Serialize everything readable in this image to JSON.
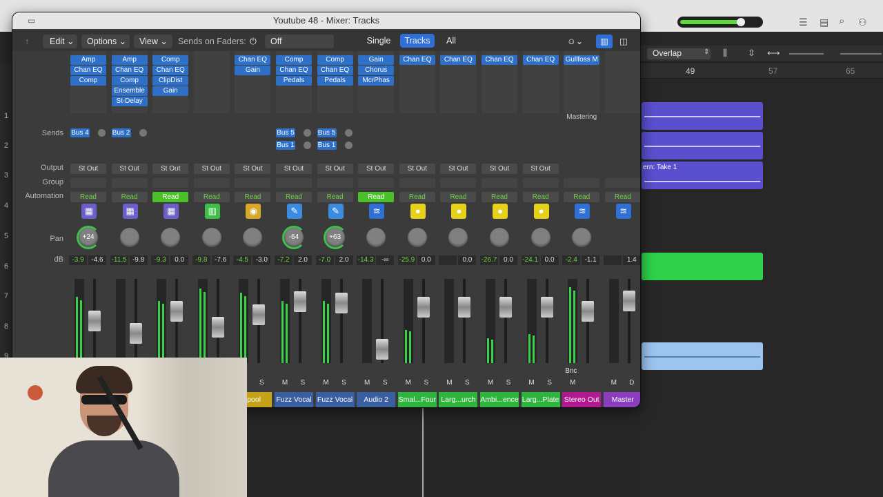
{
  "window": {
    "title": "Youtube 48 - Mixer: Tracks"
  },
  "toolbar": {
    "edit": "Edit",
    "options": "Options",
    "view": "View",
    "sends_label": "Sends on Faders:",
    "sends_value": "Off",
    "single": "Single",
    "tracks": "Tracks",
    "all": "All"
  },
  "arrange": {
    "mode": "Overlap",
    "bar1": "49",
    "bar2": "57",
    "bar3": "65",
    "region_text": "ern: Take 1"
  },
  "row_numbers": [
    "1",
    "2",
    "3",
    "4",
    "5",
    "6",
    "7",
    "8",
    "9"
  ],
  "row_labels": {
    "sends": "Sends",
    "output": "Output",
    "group": "Group",
    "automation": "Automation",
    "pan": "Pan",
    "db": "dB"
  },
  "strips": [
    {
      "name": "",
      "plugins": [
        "Amp",
        "Chan EQ",
        "Comp"
      ],
      "sends": [
        "Bus 4"
      ],
      "output": "St Out",
      "auto": "Read",
      "auto_on": false,
      "icon": "amp-icon",
      "pan": "+24",
      "db1": "-3.9",
      "db2": "-4.6",
      "fader": 0.5,
      "meter": 0.8,
      "color": "#3a3a3a",
      "buttons": "M S"
    },
    {
      "name": "",
      "plugins": [
        "Amp",
        "Chan EQ",
        "Comp",
        "Ensemble",
        "St-Delay"
      ],
      "sends": [
        "Bus 2"
      ],
      "output": "St Out",
      "auto": "Read",
      "auto_on": false,
      "icon": "amp-icon",
      "pan": "",
      "db1": "-11.5",
      "db2": "-9.8",
      "fader": 0.3,
      "meter": 0,
      "color": "#3a3a3a",
      "buttons": "M S"
    },
    {
      "name": "",
      "plugins": [
        "Comp",
        "Chan EQ",
        "ClipDist",
        "Gain"
      ],
      "sends": [],
      "output": "St Out",
      "auto": "Read",
      "auto_on": true,
      "icon": "amp-icon",
      "pan": "",
      "db1": "-9.3",
      "db2": "0.0",
      "fader": 0.65,
      "meter": 0.75,
      "color": "#3a3a3a",
      "buttons": "M S"
    },
    {
      "name": "",
      "plugins": [],
      "sends": [],
      "output": "St Out",
      "auto": "Read",
      "auto_on": false,
      "icon": "synth-icon",
      "pan": "",
      "db1": "-9.8",
      "db2": "-7.6",
      "fader": 0.4,
      "meter": 0.9,
      "color": "#3a3a3a",
      "buttons": "M S"
    },
    {
      "name": "rpool",
      "plugins": [
        "Chan EQ",
        "Gain"
      ],
      "sends": [],
      "output": "St Out",
      "auto": "Read",
      "auto_on": false,
      "icon": "drum-icon",
      "pan": "",
      "db1": "-4.5",
      "db2": "-3.0",
      "fader": 0.6,
      "meter": 0.85,
      "color": "#c4a21a",
      "buttons": "M S"
    },
    {
      "name": "Fuzz Vocal",
      "plugins": [
        "Comp",
        "Chan EQ",
        "Pedals"
      ],
      "sends": [
        "Bus 5",
        "Bus 1"
      ],
      "output": "St Out",
      "auto": "Read",
      "auto_on": false,
      "icon": "guitar-icon",
      "pan": "-64",
      "db1": "-7.2",
      "db2": "2.0",
      "fader": 0.8,
      "meter": 0.75,
      "color": "#3a5fa0",
      "buttons": "M S"
    },
    {
      "name": "Fuzz Vocal",
      "plugins": [
        "Comp",
        "Chan EQ",
        "Pedals"
      ],
      "sends": [
        "Bus 5",
        "Bus 1"
      ],
      "output": "St Out",
      "auto": "Read",
      "auto_on": false,
      "icon": "guitar-icon",
      "pan": "+63",
      "db1": "-7.0",
      "db2": "2.0",
      "fader": 0.78,
      "meter": 0.75,
      "color": "#3a5fa0",
      "buttons": "M S"
    },
    {
      "name": "Audio 2",
      "plugins": [
        "Gain",
        "Chorus",
        "McrPhas"
      ],
      "sends": [],
      "output": "St Out",
      "auto": "Read",
      "auto_on": true,
      "icon": "wave-icon",
      "pan": "",
      "db1": "-14.3",
      "db2": "-∞",
      "fader": 0.05,
      "meter": 0,
      "color": "#3a5fa0",
      "buttons": "M S"
    },
    {
      "name": "Smal...Four",
      "plugins": [
        "Chan EQ"
      ],
      "sends": [],
      "output": "St Out",
      "auto": "Read",
      "auto_on": false,
      "icon": "aux-icon",
      "pan": "",
      "db1": "-25.9",
      "db2": "0.0",
      "fader": 0.72,
      "meter": 0.4,
      "color": "#2fb53e",
      "buttons": "M S"
    },
    {
      "name": "Larg...urch",
      "plugins": [
        "Chan EQ"
      ],
      "sends": [],
      "output": "St Out",
      "auto": "Read",
      "auto_on": false,
      "icon": "aux-icon",
      "pan": "",
      "db1": "",
      "db2": "0.0",
      "fader": 0.72,
      "meter": 0,
      "color": "#2fb53e",
      "buttons": "M S"
    },
    {
      "name": "Ambi...ence",
      "plugins": [
        "Chan EQ"
      ],
      "sends": [],
      "output": "St Out",
      "auto": "Read",
      "auto_on": false,
      "icon": "aux-icon",
      "pan": "",
      "db1": "-26.7",
      "db2": "0.0",
      "fader": 0.72,
      "meter": 0.3,
      "color": "#2fb53e",
      "buttons": "M S"
    },
    {
      "name": "Larg...Plate",
      "plugins": [
        "Chan EQ"
      ],
      "sends": [],
      "output": "St Out",
      "auto": "Read",
      "auto_on": false,
      "icon": "aux-icon",
      "pan": "",
      "db1": "-24.1",
      "db2": "0.0",
      "fader": 0.72,
      "meter": 0.35,
      "color": "#2fb53e",
      "buttons": "M S"
    },
    {
      "name": "Stereo Out",
      "plugins": [
        "Gullfoss M"
      ],
      "sends": [],
      "output": "",
      "auto": "Read",
      "auto_on": false,
      "icon": "wave-icon",
      "pan": "",
      "db1": "-2.4",
      "db2": "-1.1",
      "fader": 0.65,
      "meter": 0.92,
      "color": "#b0198f",
      "buttons": "M",
      "extra": "Mastering",
      "bnc": "Bnc"
    },
    {
      "name": "Master",
      "plugins": [],
      "sends": [],
      "output": "",
      "auto": "Read",
      "auto_on": false,
      "icon": "wave-icon",
      "pan": "",
      "db1": "",
      "db2": "1.4",
      "fader": 0.82,
      "meter": 0,
      "color": "#8a3dbd",
      "buttons": "M D"
    }
  ]
}
